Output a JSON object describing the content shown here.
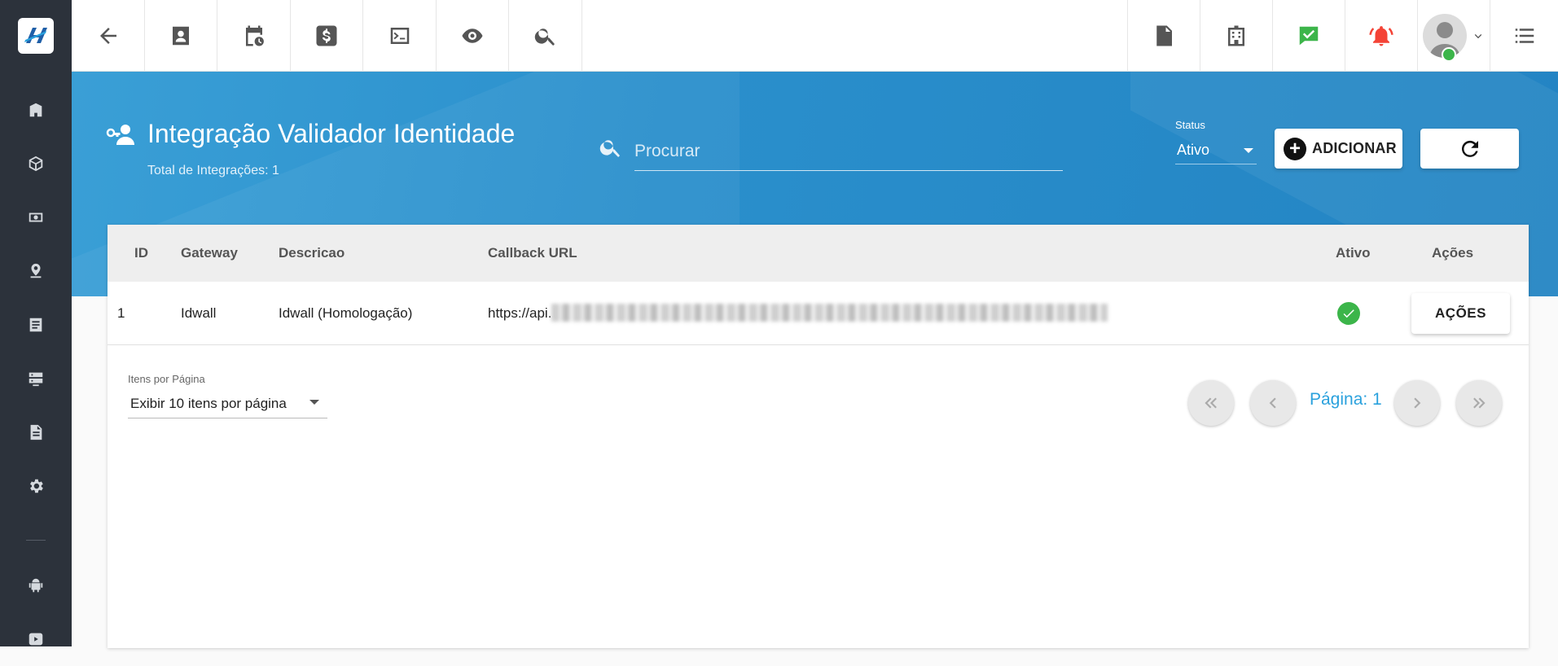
{
  "sidebar": {
    "logo": "brand-logo",
    "items": [
      {
        "icon": "building-icon"
      },
      {
        "icon": "cube-icon"
      },
      {
        "icon": "money-icon"
      },
      {
        "icon": "map-pin-icon"
      },
      {
        "icon": "list-icon"
      },
      {
        "icon": "server-icon"
      },
      {
        "icon": "document-icon"
      },
      {
        "icon": "gear-icon"
      }
    ],
    "bottom_items": [
      {
        "icon": "android-icon"
      },
      {
        "icon": "youtube-icon"
      }
    ]
  },
  "topbar": {
    "left_buttons": [
      "back-arrow-icon",
      "contact-card-icon",
      "calendar-clock-icon",
      "dollar-icon",
      "terminal-icon",
      "eye-icon",
      "search-icon"
    ],
    "right_buttons": [
      "pdf-icon",
      "building-icon",
      "chat-check-icon",
      "bell-alert-icon",
      "avatar",
      "menu-list-icon"
    ],
    "colors": {
      "chat": "#3cb54a",
      "bell": "#f44336"
    }
  },
  "header": {
    "title": "Integração Validador Identidade",
    "subtitle": "Total de Integrações: 1",
    "search_placeholder": "Procurar",
    "status_label": "Status",
    "status_value": "Ativo",
    "add_label": "ADICIONAR"
  },
  "table": {
    "columns": [
      "ID",
      "Gateway",
      "Descricao",
      "Callback URL",
      "Ativo",
      "Ações"
    ],
    "rows": [
      {
        "id": "1",
        "gateway": "Idwall",
        "descricao": "Idwall (Homologação)",
        "callback_prefix": "https://api.",
        "ativo": true,
        "actions_label": "AÇÕES"
      }
    ]
  },
  "pagination": {
    "per_page_label": "Itens por Página",
    "per_page_value": "Exibir 10 itens por página",
    "page_label": "Página: 1"
  },
  "colors": {
    "accent": "#2a8fcc",
    "sidebar": "#2c323b",
    "link": "#2aa1dd",
    "success": "#3cb54a"
  }
}
